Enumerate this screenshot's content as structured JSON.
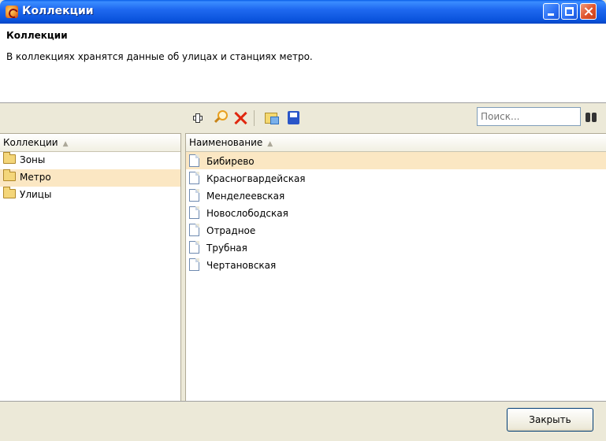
{
  "window": {
    "title": "Коллекции",
    "controls": [
      "minimize-icon",
      "maximize-icon",
      "close-icon"
    ]
  },
  "header": {
    "title": "Коллекции",
    "description": "В коллекциях хранятся данные об улицах и станциях метро."
  },
  "toolbar": {
    "icons": [
      "add-icon",
      "search-icon",
      "delete-icon",
      "edit-icon",
      "save-icon"
    ],
    "search_placeholder": "Поиск...",
    "search_button_icon": "binoculars-icon"
  },
  "collections": {
    "column_header": "Коллекции",
    "items": [
      {
        "label": "Зоны",
        "selected": false
      },
      {
        "label": "Метро",
        "selected": true
      },
      {
        "label": "Улицы",
        "selected": false
      }
    ]
  },
  "entries": {
    "column_header": "Наименование",
    "items": [
      {
        "label": "Бибирево",
        "selected": true
      },
      {
        "label": "Красногвардейская",
        "selected": false
      },
      {
        "label": "Менделеевская",
        "selected": false
      },
      {
        "label": "Новослободская",
        "selected": false
      },
      {
        "label": "Отрадное",
        "selected": false
      },
      {
        "label": "Трубная",
        "selected": false
      },
      {
        "label": "Чертановская",
        "selected": false
      }
    ]
  },
  "footer": {
    "close_label": "Закрыть"
  },
  "colors": {
    "titlebar": "#0a53dc",
    "selection": "#fbe7c3",
    "dialog_bg": "#ece9d8"
  }
}
